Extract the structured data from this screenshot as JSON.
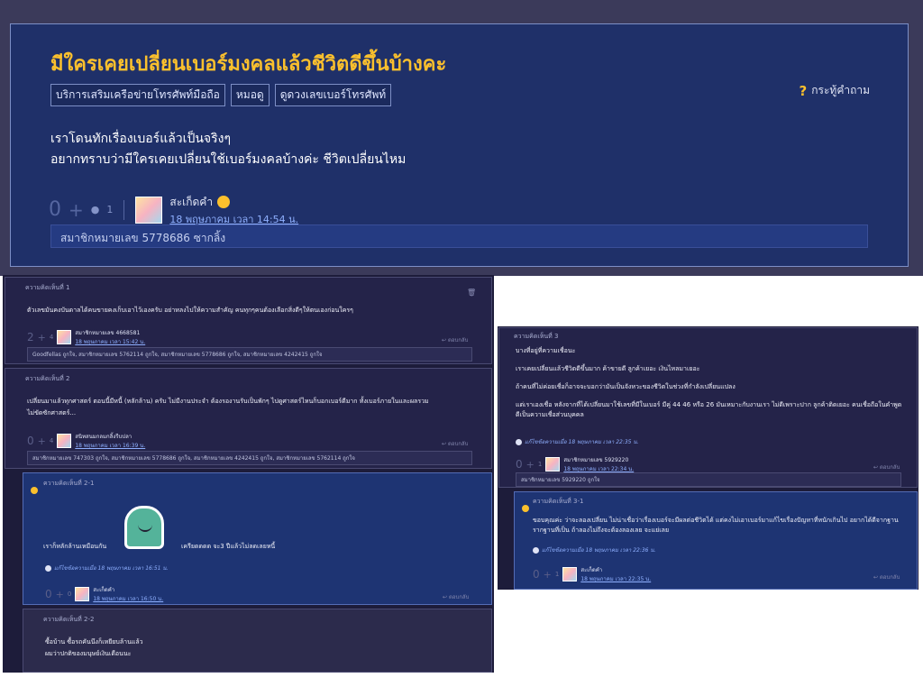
{
  "topic": {
    "title": "มีใครเคยเปลี่ยนเบอร์มงคลแล้วชีวิตดีขึ้นบ้างคะ",
    "tags": [
      "บริการเสริมเครือข่ายโทรศัพท์มือถือ",
      "หมอดู",
      "ดูดวงเลขเบอร์โทรศัพท์"
    ],
    "type_label": "กระทู้คำถาม",
    "body_line1": "เราโดนทักเรื่องเบอร์แล้วเป็นจริงๆ",
    "body_line2": "อยากทราบว่ามีใครเคยเปลี่ยนใช้เบอร์มงคลบ้างค่ะ ชีวิตเปลี่ยนไหม",
    "score": "0",
    "emotion_count": "1",
    "author": "สะเก็ดคำ",
    "date": "18 พฤษภาคม เวลา 14:54 น.",
    "member": "สมาชิกหมายเลข 5778686 ซากลิ้ง"
  },
  "comments": {
    "c1": {
      "label": "ความคิดเห็นที่ 1",
      "text": "ตัวเลขมันคงบันดาลได้คนขายคงเก็บเอาไว้เองครับ อย่าหลงไปให้ความสำคัญ คนทุกๆคนต้องเลือกสิ่งดีๆให้ตนเองก่อนใครๆ",
      "score": "2",
      "emotions": "4",
      "author": "สมาชิกหมายเลข 4668581",
      "date": "18 พฤษภาคม เวลา 15:42 น.",
      "reply": "ตอบกลับ",
      "likes": "Goodfellas ถูกใจ, สมาชิกหมายเลข 5762114 ถูกใจ, สมาชิกหมายเลข 5778686 ถูกใจ, สมาชิกหมายเลข 4242415 ถูกใจ"
    },
    "c2": {
      "label": "ความคิดเห็นที่ 2",
      "text1": "เปลี่ยนมาแล้วทุกศาสตร์ ตอนนี้มีหนี้ (หลักล้าน) ครับ ไม่มีงานประจำ ต้องรองานรับเป็นพักๆ ไปดูศาสตร์ไหนก็บอกเบอร์ดีมาก ทั้งเบอร์ภายในและผลรวม",
      "text2": "ไม่ขัดซักศาสตร์...",
      "score": "0",
      "emotions": "4",
      "author": "สนิทสนมกลมกลิ้งรีบปลา",
      "date": "18 พฤษภาคม เวลา 16:39 น.",
      "reply": "ตอบกลับ",
      "likes": "สมาชิกหมายเลข 747303 ถูกใจ, สมาชิกหมายเลข 5778686 ถูกใจ, สมาชิกหมายเลข 4242415 ถูกใจ, สมาชิกหมายเลข 5762114 ถูกใจ"
    },
    "c21": {
      "label": "ความคิดเห็นที่ 2-1",
      "left_text": "เราก็หลักล้านเหมือนกัน",
      "right_text": "เครียดดดด จะ3 ปีแล้วไม่ลดเลยหนี้",
      "edited": "แก้ไขข้อความเมื่อ 18 พฤษภาคม เวลา 16:51 น.",
      "score": "0",
      "emotions": "0",
      "author": "สะเก็ดคำ",
      "date": "18 พฤษภาคม เวลา 16:50 น.",
      "reply": "ตอบกลับ"
    },
    "c22": {
      "label": "ความคิดเห็นที่ 2-2",
      "text1": "ซื้อบ้าน ซื้อรถคันนึงก็เหยียบล้านแล้ว",
      "text2": "ผมว่าปกติของมนุษย์เงินเดือนนะ"
    },
    "c3": {
      "label": "ความคิดเห็นที่ 3",
      "p1": "บางที่อยู่ที่ความเชื่อนะ",
      "p2": "เราเคยเปลี่ยนแล้วชีวิตดีขึ้นมาก ค้าขายดี ลูกค้าเยอะ เงินไหลมาเยอะ",
      "p3": "ถ้าคนที่ไม่ค่อยเชื่อก็อาจจะบอกว่ามันเป็นจังหวะของชีวิตในช่วงที่กำลังเปลี่ยนแปลง",
      "p4a": "แต่เราเองเชื่อ หลังจากที่ได้เปลี่ยนมาใช้เลขที่มีในเบอร์ มีคู่ 44 46 หรือ 26 มันเหมาะกับงานเรา  ไม่ดีเพราะปาก ลูกค้าติดเยอะ คนเชื่อถือในคำพูด",
      "p4b": "ดีเป็นความเชื่อส่วนบุคคล",
      "edited": "แก้ไขข้อความเมื่อ 18 พฤษภาคม เวลา 22:35 น.",
      "score": "0",
      "emotions": "1",
      "author": "สมาชิกหมายเลข 5929220",
      "date": "18 พฤษภาคม เวลา 22:34 น.",
      "reply": "ตอบกลับ",
      "likes": "สมาชิกหมายเลข 5929220 ถูกใจ"
    },
    "c31": {
      "label": "ความคิดเห็นที่ 3-1",
      "text1": "ขอบคุณค่ะ  ว่าจะลองเปลี่ยน ไม่น่าเชื่อว่าเรื่องเบอร์จะมีผลต่อชีวิตได้ แต่คงไม่เอาเบอร์มาแก้ไขเรื่องปัญหาที่หนักเกินไป อยากได้ดีจากฐาน",
      "text2": "รากฐานที่เป็น ถ้าลองไม่ถึงจะต้องลองเลย จะแย่เลย",
      "edited": "แก้ไขข้อความเมื่อ 18 พฤษภาคม เวลา 22:36 น.",
      "score": "0",
      "emotions": "1",
      "author": "สะเก็ดคำ",
      "date": "18 พฤษภาคม เวลา 22:35 น.",
      "reply": "ตอบกลับ"
    }
  },
  "icons": {
    "plus": "+",
    "question": "?",
    "trash": "🗑",
    "reply": "↩"
  },
  "colors": {
    "accent": "#fbc02d",
    "topic_bg": "#1f3069",
    "comment_bg": "#242349",
    "sub_bg": "#1e3473"
  }
}
